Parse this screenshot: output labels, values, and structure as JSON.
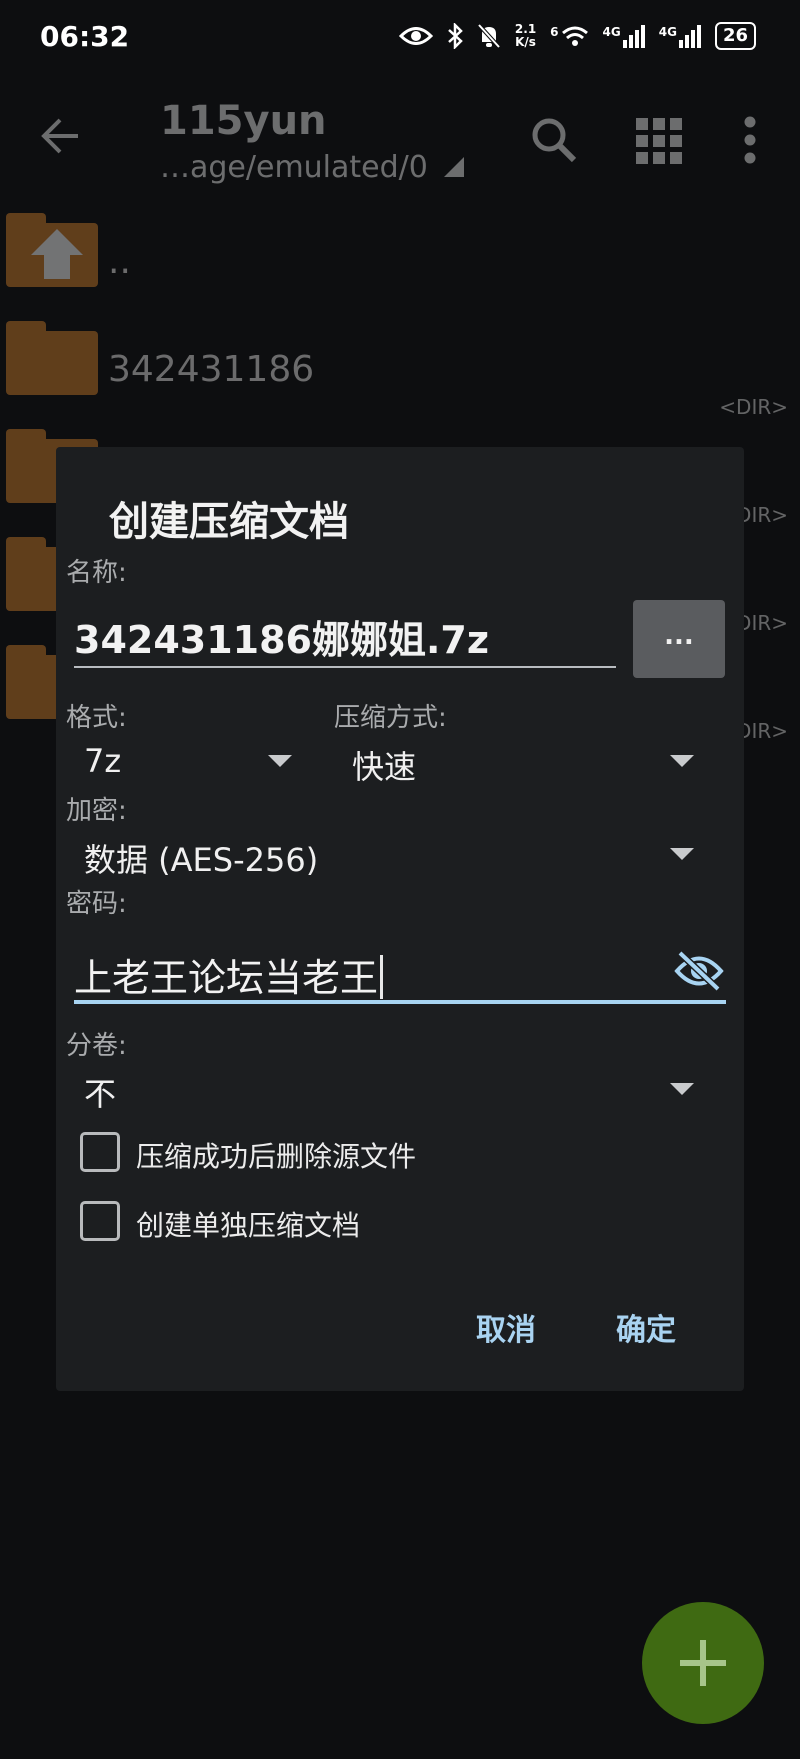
{
  "status_bar": {
    "time": "06:32",
    "net_speed_value": "2.1",
    "net_speed_unit": "K/s",
    "wifi_label": "6",
    "sim1_label": "4G",
    "sim2_label": "4G",
    "battery": "26"
  },
  "app_bar": {
    "title": "115yun",
    "path": "…age/emulated/0"
  },
  "file_list": {
    "parent_label": "..",
    "items": [
      {
        "name": "342431186",
        "tag": "<DIR>"
      },
      {
        "name": "",
        "tag": "<DIR>"
      },
      {
        "name": "",
        "tag": "<DIR>"
      },
      {
        "name": "",
        "tag": "<DIR>"
      }
    ]
  },
  "dialog": {
    "title": "创建压缩文档",
    "name_label": "名称:",
    "name_value": "342431186娜娜姐.7z",
    "browse_label": "...",
    "format_label": "格式:",
    "format_value": "7z",
    "method_label": "压缩方式:",
    "method_value": "快速",
    "encryption_label": "加密:",
    "encryption_value": "数据 (AES-256)",
    "password_label": "密码:",
    "password_value": "上老王论坛当老王",
    "split_label": "分卷:",
    "split_value": "不",
    "checkbox_delete_source": "压缩成功后删除源文件",
    "checkbox_separate_archive": "创建单独压缩文档",
    "cancel_label": "取消",
    "ok_label": "确定"
  },
  "colors": {
    "background": "#0d0e10",
    "dialog": "#1c1e20",
    "accent": "#a9d3f1",
    "folder": "#c6782a",
    "fab": "#3f6a12"
  },
  "icons": [
    "back-arrow-icon",
    "search-icon",
    "grid-view-icon",
    "more-vert-icon",
    "folder-icon",
    "folder-up-icon",
    "visibility-off-icon",
    "add-icon",
    "eye-icon",
    "bluetooth-icon",
    "bell-off-icon",
    "wifi-icon",
    "signal-icon"
  ]
}
